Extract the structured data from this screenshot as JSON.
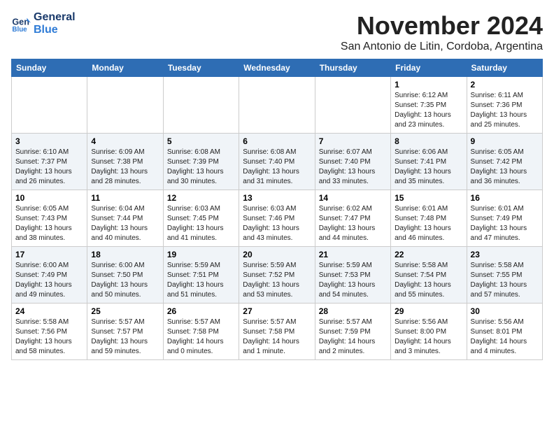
{
  "header": {
    "logo_line1": "General",
    "logo_line2": "Blue",
    "month_title": "November 2024",
    "subtitle": "San Antonio de Litin, Cordoba, Argentina"
  },
  "days_of_week": [
    "Sunday",
    "Monday",
    "Tuesday",
    "Wednesday",
    "Thursday",
    "Friday",
    "Saturday"
  ],
  "weeks": [
    [
      {
        "day": "",
        "info": ""
      },
      {
        "day": "",
        "info": ""
      },
      {
        "day": "",
        "info": ""
      },
      {
        "day": "",
        "info": ""
      },
      {
        "day": "",
        "info": ""
      },
      {
        "day": "1",
        "info": "Sunrise: 6:12 AM\nSunset: 7:35 PM\nDaylight: 13 hours\nand 23 minutes."
      },
      {
        "day": "2",
        "info": "Sunrise: 6:11 AM\nSunset: 7:36 PM\nDaylight: 13 hours\nand 25 minutes."
      }
    ],
    [
      {
        "day": "3",
        "info": "Sunrise: 6:10 AM\nSunset: 7:37 PM\nDaylight: 13 hours\nand 26 minutes."
      },
      {
        "day": "4",
        "info": "Sunrise: 6:09 AM\nSunset: 7:38 PM\nDaylight: 13 hours\nand 28 minutes."
      },
      {
        "day": "5",
        "info": "Sunrise: 6:08 AM\nSunset: 7:39 PM\nDaylight: 13 hours\nand 30 minutes."
      },
      {
        "day": "6",
        "info": "Sunrise: 6:08 AM\nSunset: 7:40 PM\nDaylight: 13 hours\nand 31 minutes."
      },
      {
        "day": "7",
        "info": "Sunrise: 6:07 AM\nSunset: 7:40 PM\nDaylight: 13 hours\nand 33 minutes."
      },
      {
        "day": "8",
        "info": "Sunrise: 6:06 AM\nSunset: 7:41 PM\nDaylight: 13 hours\nand 35 minutes."
      },
      {
        "day": "9",
        "info": "Sunrise: 6:05 AM\nSunset: 7:42 PM\nDaylight: 13 hours\nand 36 minutes."
      }
    ],
    [
      {
        "day": "10",
        "info": "Sunrise: 6:05 AM\nSunset: 7:43 PM\nDaylight: 13 hours\nand 38 minutes."
      },
      {
        "day": "11",
        "info": "Sunrise: 6:04 AM\nSunset: 7:44 PM\nDaylight: 13 hours\nand 40 minutes."
      },
      {
        "day": "12",
        "info": "Sunrise: 6:03 AM\nSunset: 7:45 PM\nDaylight: 13 hours\nand 41 minutes."
      },
      {
        "day": "13",
        "info": "Sunrise: 6:03 AM\nSunset: 7:46 PM\nDaylight: 13 hours\nand 43 minutes."
      },
      {
        "day": "14",
        "info": "Sunrise: 6:02 AM\nSunset: 7:47 PM\nDaylight: 13 hours\nand 44 minutes."
      },
      {
        "day": "15",
        "info": "Sunrise: 6:01 AM\nSunset: 7:48 PM\nDaylight: 13 hours\nand 46 minutes."
      },
      {
        "day": "16",
        "info": "Sunrise: 6:01 AM\nSunset: 7:49 PM\nDaylight: 13 hours\nand 47 minutes."
      }
    ],
    [
      {
        "day": "17",
        "info": "Sunrise: 6:00 AM\nSunset: 7:49 PM\nDaylight: 13 hours\nand 49 minutes."
      },
      {
        "day": "18",
        "info": "Sunrise: 6:00 AM\nSunset: 7:50 PM\nDaylight: 13 hours\nand 50 minutes."
      },
      {
        "day": "19",
        "info": "Sunrise: 5:59 AM\nSunset: 7:51 PM\nDaylight: 13 hours\nand 51 minutes."
      },
      {
        "day": "20",
        "info": "Sunrise: 5:59 AM\nSunset: 7:52 PM\nDaylight: 13 hours\nand 53 minutes."
      },
      {
        "day": "21",
        "info": "Sunrise: 5:59 AM\nSunset: 7:53 PM\nDaylight: 13 hours\nand 54 minutes."
      },
      {
        "day": "22",
        "info": "Sunrise: 5:58 AM\nSunset: 7:54 PM\nDaylight: 13 hours\nand 55 minutes."
      },
      {
        "day": "23",
        "info": "Sunrise: 5:58 AM\nSunset: 7:55 PM\nDaylight: 13 hours\nand 57 minutes."
      }
    ],
    [
      {
        "day": "24",
        "info": "Sunrise: 5:58 AM\nSunset: 7:56 PM\nDaylight: 13 hours\nand 58 minutes."
      },
      {
        "day": "25",
        "info": "Sunrise: 5:57 AM\nSunset: 7:57 PM\nDaylight: 13 hours\nand 59 minutes."
      },
      {
        "day": "26",
        "info": "Sunrise: 5:57 AM\nSunset: 7:58 PM\nDaylight: 14 hours\nand 0 minutes."
      },
      {
        "day": "27",
        "info": "Sunrise: 5:57 AM\nSunset: 7:58 PM\nDaylight: 14 hours\nand 1 minute."
      },
      {
        "day": "28",
        "info": "Sunrise: 5:57 AM\nSunset: 7:59 PM\nDaylight: 14 hours\nand 2 minutes."
      },
      {
        "day": "29",
        "info": "Sunrise: 5:56 AM\nSunset: 8:00 PM\nDaylight: 14 hours\nand 3 minutes."
      },
      {
        "day": "30",
        "info": "Sunrise: 5:56 AM\nSunset: 8:01 PM\nDaylight: 14 hours\nand 4 minutes."
      }
    ]
  ]
}
